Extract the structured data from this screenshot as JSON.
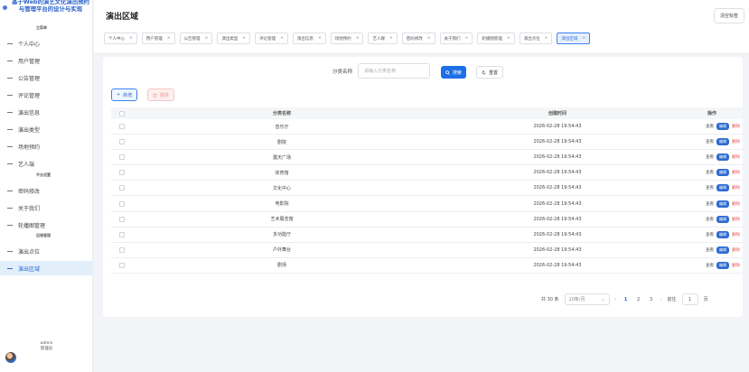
{
  "sidebar": {
    "brand_title": "基于Web的演艺文化演出预约与管理平台的设计与实现",
    "sections": [
      "主菜单",
      "平台设置",
      "运维管理"
    ],
    "items": [
      {
        "label": "个人中心"
      },
      {
        "label": "用户管理"
      },
      {
        "label": "公告管理"
      },
      {
        "label": "评论管理"
      },
      {
        "label": "演出信息"
      },
      {
        "label": "演出类型"
      },
      {
        "label": "场地预约"
      },
      {
        "label": "艺人端"
      },
      {
        "label": "密码修改"
      },
      {
        "label": "关于我们"
      },
      {
        "label": "轮播图管理"
      },
      {
        "label": "演出点位"
      },
      {
        "label": "演出区域"
      }
    ],
    "user": {
      "name": "admin",
      "role": "管理员"
    }
  },
  "header": {
    "title": "演出区域",
    "clear_tabs": "清空标签",
    "tabs": [
      {
        "label": "个人中心"
      },
      {
        "label": "用户管理"
      },
      {
        "label": "公告管理"
      },
      {
        "label": "演出类型"
      },
      {
        "label": "评论管理"
      },
      {
        "label": "演出信息"
      },
      {
        "label": "场地预约"
      },
      {
        "label": "艺人端"
      },
      {
        "label": "密码修改"
      },
      {
        "label": "关于我们"
      },
      {
        "label": "轮播图管理"
      },
      {
        "label": "演出点位"
      },
      {
        "label": "演出区域"
      }
    ],
    "tab_close": "×"
  },
  "search": {
    "label": "分类名称",
    "placeholder": "请输入分类名称",
    "search_button": "搜索",
    "reset_button": "重置"
  },
  "actions": {
    "add": "新增",
    "delete": "删除"
  },
  "table": {
    "headers": {
      "name": "分类名称",
      "time": "创建时间",
      "ops": "操作"
    },
    "op_labels": {
      "view": "查看",
      "edit": "编辑",
      "delete": "删除"
    },
    "rows": [
      {
        "name": "音乐厅",
        "time": "2026-02-28 19:54:43"
      },
      {
        "name": "剧院",
        "time": "2026-02-28 19:54:43"
      },
      {
        "name": "露天广场",
        "time": "2026-02-28 19:54:43"
      },
      {
        "name": "体育馆",
        "time": "2026-02-28 19:54:43"
      },
      {
        "name": "文化中心",
        "time": "2026-02-28 19:54:43"
      },
      {
        "name": "电影院",
        "time": "2026-02-28 19:54:43"
      },
      {
        "name": "艺术展览馆",
        "time": "2026-02-28 19:54:43"
      },
      {
        "name": "多功能厅",
        "time": "2026-02-28 19:54:43"
      },
      {
        "name": "户外舞台",
        "time": "2026-02-28 19:54:43"
      },
      {
        "name": "剧场",
        "time": "2026-02-28 19:54:43"
      }
    ]
  },
  "pagination": {
    "total": "共 30 条",
    "page_size": "10条/页",
    "pages": [
      "1",
      "2",
      "3"
    ],
    "current": "1",
    "goto_label": "前往",
    "goto_value": "1",
    "page_unit": "页"
  },
  "colors": {
    "primary": "#1e6fe6",
    "danger": "#e25252",
    "active_bg": "#e3eefb"
  }
}
